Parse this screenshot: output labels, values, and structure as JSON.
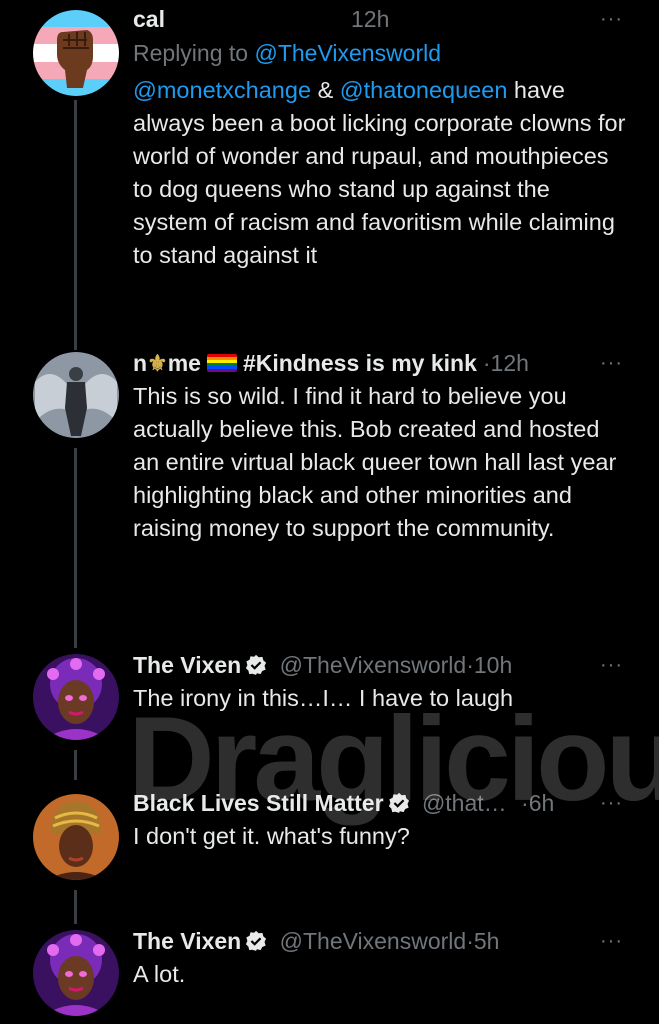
{
  "tweets": [
    {
      "name": "cal",
      "time": "12h",
      "more": "···",
      "reply_prefix": "Replying to",
      "reply_handle": "@TheVixensworld",
      "mention1": "@monetxchange",
      "amp": "&",
      "mention2": "@thatonequeen",
      "body": " have always been a boot licking corporate clowns for world of wonder and rupaul, and mouthpieces to dog queens who stand up against the system of racism and favoritism while claiming to stand against it"
    },
    {
      "name_part1": "n",
      "name_fleur": "⚜",
      "name_part2": "me",
      "name_part3": "#Kindness is my kink",
      "dot": "·",
      "time": "12h",
      "more": "···",
      "body": "This is so wild. I find it hard to believe you actually believe this. Bob created and hosted an entire virtual black queer town hall last year highlighting black and other minorities and raising money to support the community."
    },
    {
      "name": "The Vixen",
      "handle": "@TheVixensworld",
      "dot": "·",
      "time": "10h",
      "more": "···",
      "body": "The irony in this…I… I have to laugh"
    },
    {
      "name": "Black Lives Still Matter",
      "handle": "@that…",
      "dot": "·",
      "time": "6h",
      "more": "···",
      "body": "I don't get it. what's funny?"
    },
    {
      "name": "The Vixen",
      "handle": "@TheVixensworld",
      "dot": "·",
      "time": "5h",
      "more": "···",
      "body": "A lot."
    }
  ],
  "watermark": "Draglicious",
  "colors": {
    "link": "#1d9bf0",
    "verified": "#e7e9ea",
    "muted": "#71767b"
  },
  "icons": [
    "fist-avatar-icon",
    "angel-avatar-icon",
    "vixen-avatar-icon",
    "headwrap-avatar-icon",
    "verified-icon",
    "more-icon",
    "pride-flag-icon",
    "fleur-de-lis-icon"
  ]
}
